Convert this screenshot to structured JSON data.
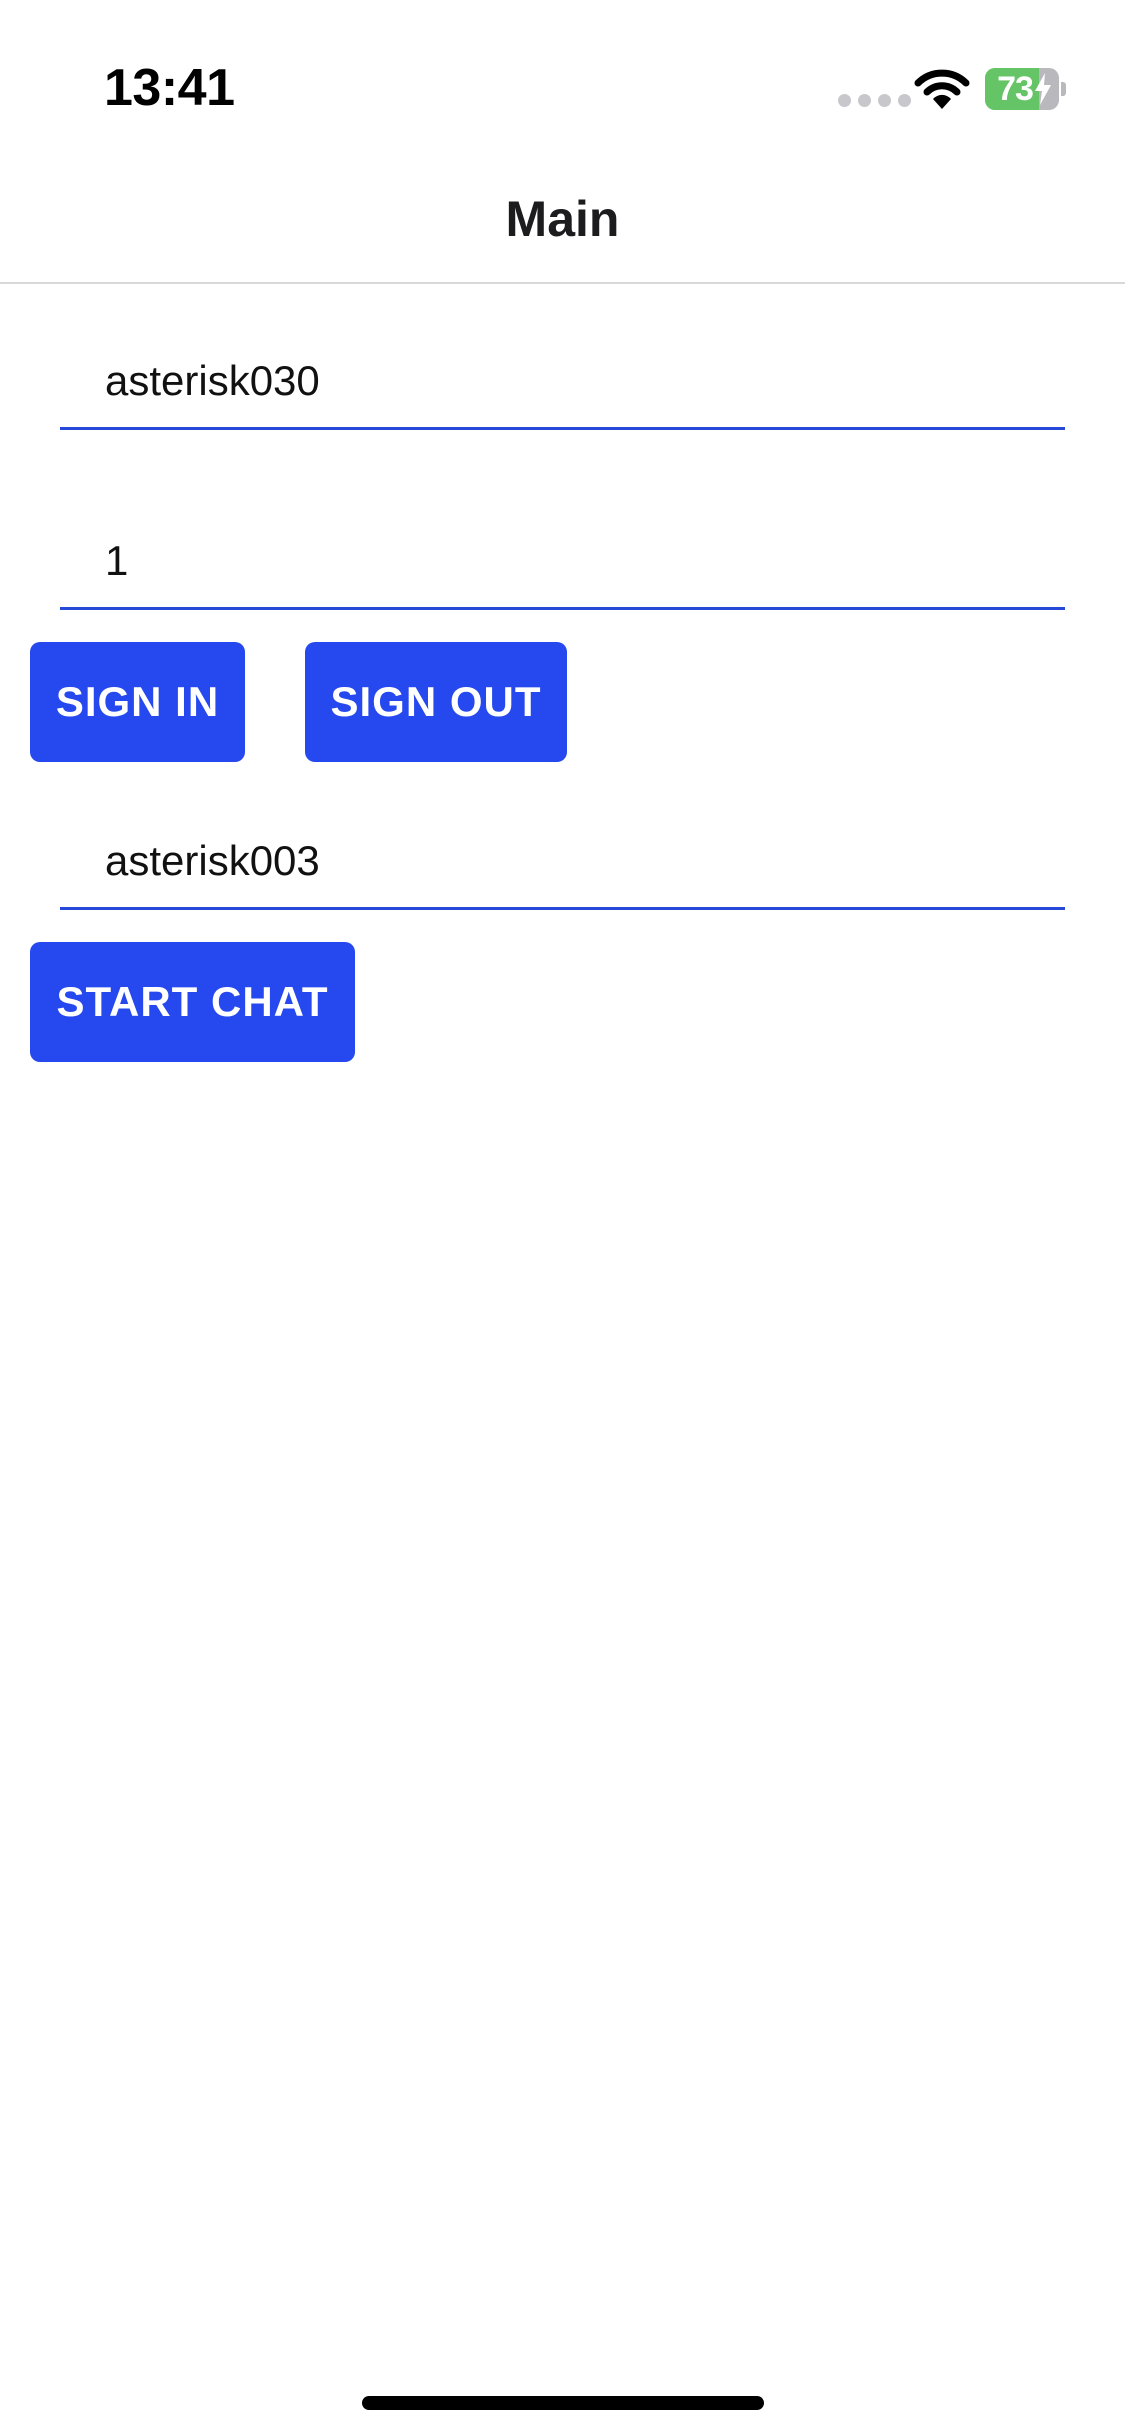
{
  "status_bar": {
    "time": "13:41",
    "battery_percent": "73",
    "battery_level": 0.73,
    "signal_icon": "signal-dots-icon",
    "wifi_icon": "wifi-icon",
    "charging_icon": "bolt-icon"
  },
  "header": {
    "title": "Main"
  },
  "form": {
    "username_value": "asterisk030",
    "password_value": "1",
    "target_value": "asterisk003"
  },
  "buttons": {
    "sign_in": "SIGN IN",
    "sign_out": "SIGN OUT",
    "start_chat": "START CHAT"
  },
  "colors": {
    "accent": "#2649ef",
    "field_underline": "#2649d8",
    "battery_fill": "#65c466"
  }
}
